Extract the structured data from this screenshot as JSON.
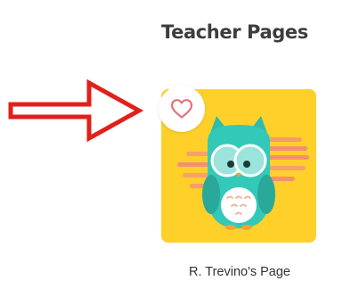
{
  "section": {
    "title": "Teacher Pages"
  },
  "card": {
    "caption": "R. Trevino's Page",
    "icon": "owl-avatar",
    "favorite_icon": "heart-outline-icon"
  },
  "colors": {
    "arrow": "#e0201b",
    "heart": "#e8707a",
    "card_background": "#ffd23a",
    "owl_body": "#33c9b8",
    "sunset_stripes": "#f58f6d"
  }
}
